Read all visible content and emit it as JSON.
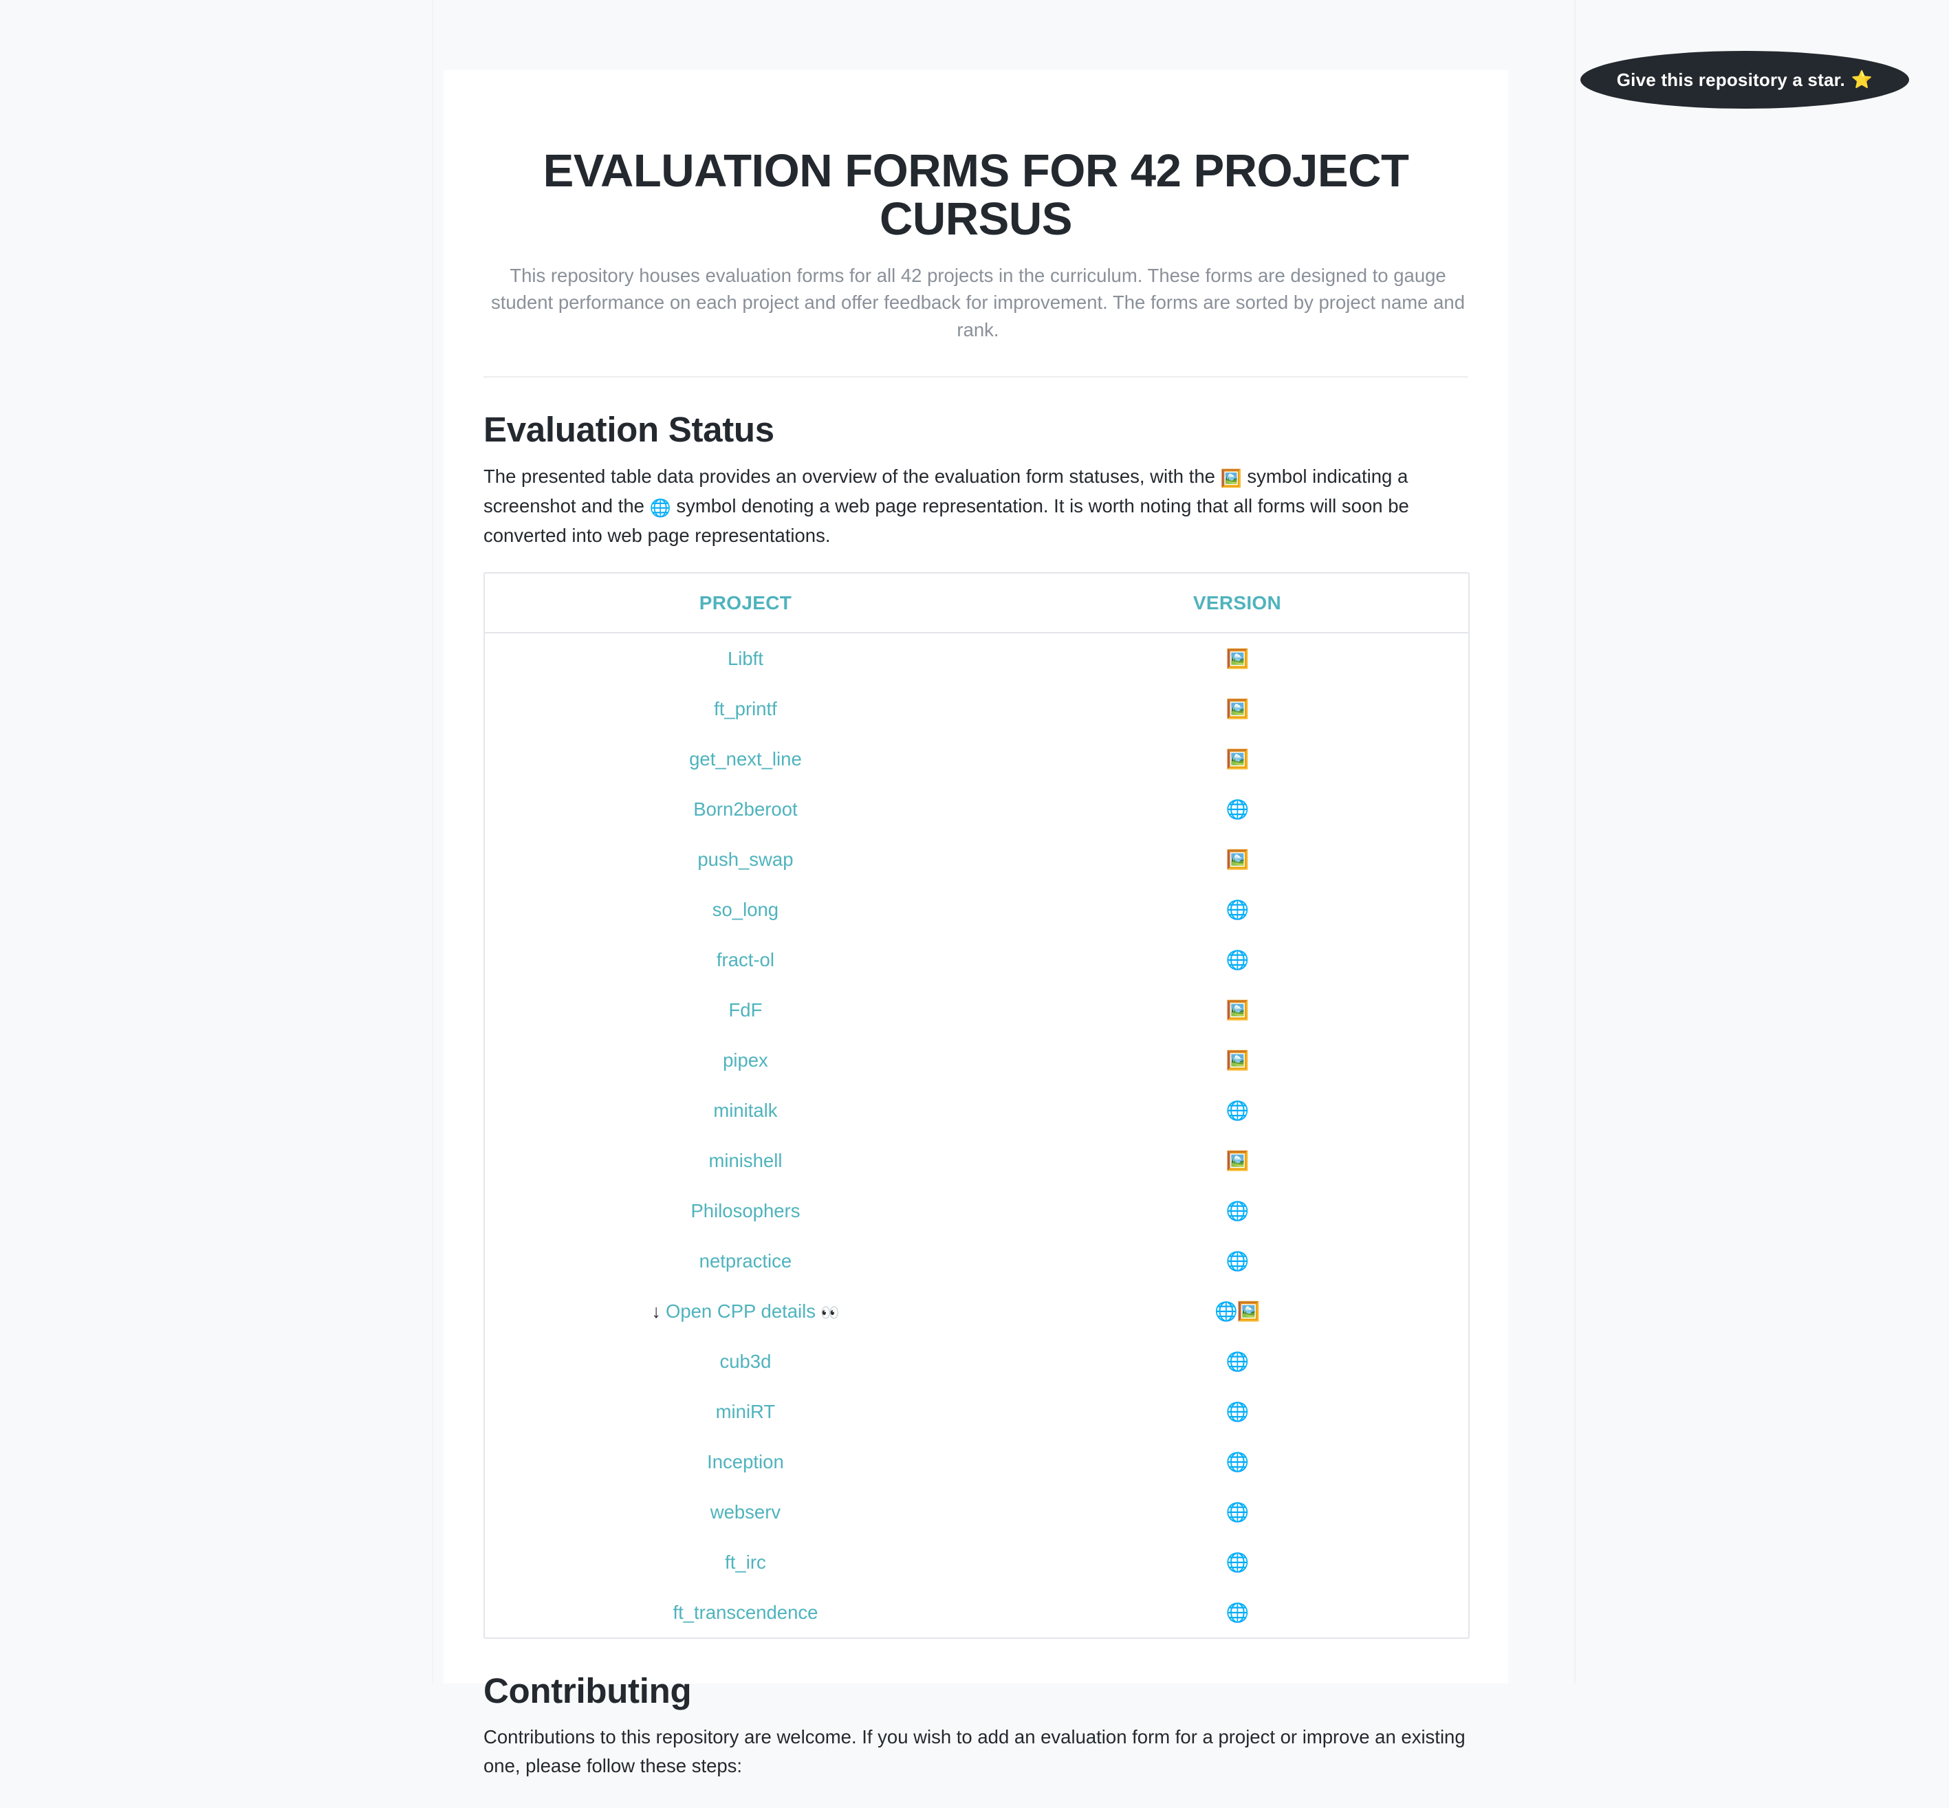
{
  "badge": {
    "label": "Give this repository a star.",
    "icon": "star-emoji",
    "glyph": "⭐",
    "background": "#24292f",
    "text_color": "#ffffff"
  },
  "header": {
    "title": "EVALUATION FORMS FOR 42 PROJECT CURSUS",
    "subtitle": "This repository houses evaluation forms for all 42 projects in the curriculum. These forms are designed to gauge student performance on each project and offer feedback for improvement. The forms are sorted by project name and rank."
  },
  "evaluation_status": {
    "heading": "Evaluation Status",
    "description_part1": "The presented table data provides an overview of the evaluation form statuses, with the ",
    "screenshot_emoji": "🖼️",
    "description_part2": " symbol indicating a screenshot and the ",
    "web_emoji": "🌐",
    "description_part3": " symbol denoting a web page representation. It is worth noting that all forms will soon be converted into web page representations.",
    "table": {
      "columns": [
        "PROJECT",
        "VERSION"
      ],
      "rows": [
        {
          "project": "Libft",
          "version": "🖼️",
          "kind": "link"
        },
        {
          "project": "ft_printf",
          "version": "🖼️",
          "kind": "link"
        },
        {
          "project": "get_next_line",
          "version": "🖼️",
          "kind": "link"
        },
        {
          "project": "Born2beroot",
          "version": "🌐",
          "kind": "link"
        },
        {
          "project": "push_swap",
          "version": "🖼️",
          "kind": "link"
        },
        {
          "project": "so_long",
          "version": "🌐",
          "kind": "link"
        },
        {
          "project": "fract-ol",
          "version": "🌐",
          "kind": "link"
        },
        {
          "project": "FdF",
          "version": "🖼️",
          "kind": "link"
        },
        {
          "project": "pipex",
          "version": "🖼️",
          "kind": "link"
        },
        {
          "project": "minitalk",
          "version": "🌐",
          "kind": "link"
        },
        {
          "project": "minishell",
          "version": "🖼️",
          "kind": "link"
        },
        {
          "project": "Philosophers",
          "version": "🌐",
          "kind": "link"
        },
        {
          "project": "netpractice",
          "version": "🌐",
          "kind": "link"
        },
        {
          "project": "Open CPP details",
          "version": "🌐🖼️",
          "kind": "details",
          "arrow": "↓",
          "suffix_emoji": "👀"
        },
        {
          "project": "cub3d",
          "version": "🌐",
          "kind": "link"
        },
        {
          "project": "miniRT",
          "version": "🌐",
          "kind": "link"
        },
        {
          "project": "Inception",
          "version": "🌐",
          "kind": "link"
        },
        {
          "project": "webserv",
          "version": "🌐",
          "kind": "link"
        },
        {
          "project": "ft_irc",
          "version": "🌐",
          "kind": "link"
        },
        {
          "project": "ft_transcendence",
          "version": "🌐",
          "kind": "link"
        }
      ]
    }
  },
  "contributing": {
    "heading": "Contributing",
    "description": "Contributions to this repository are welcome. If you wish to add an evaluation form for a project or improve an existing one, please follow these steps:"
  },
  "colors": {
    "accent_teal": "#4fb3bd",
    "text_dark": "#24292f",
    "text_muted": "#8a9099",
    "page_background": "#f8f9fa",
    "panel_background": "#ffffff",
    "border": "#e3e5e8"
  }
}
